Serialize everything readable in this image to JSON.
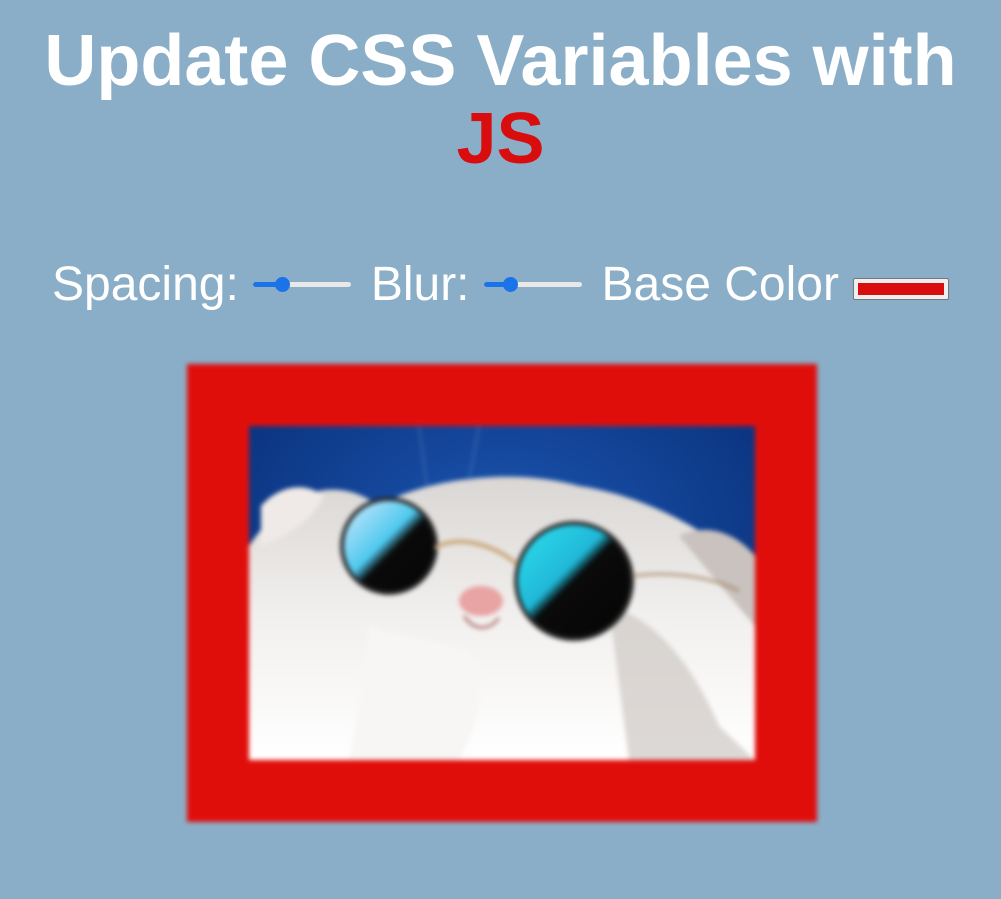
{
  "header": {
    "title": "Update CSS Variables with",
    "highlight": "JS"
  },
  "controls": {
    "spacing": {
      "label": "Spacing:",
      "value_fraction": 0.3
    },
    "blur": {
      "label": "Blur:",
      "value_fraction": 0.27
    },
    "base_color": {
      "label": "Base Color",
      "value": "#d90d0d"
    }
  },
  "image": {
    "subject": "white cat wearing round sunglasses on blue background",
    "frame_color": "#e00e0b",
    "background_color": "#8aaec8"
  }
}
